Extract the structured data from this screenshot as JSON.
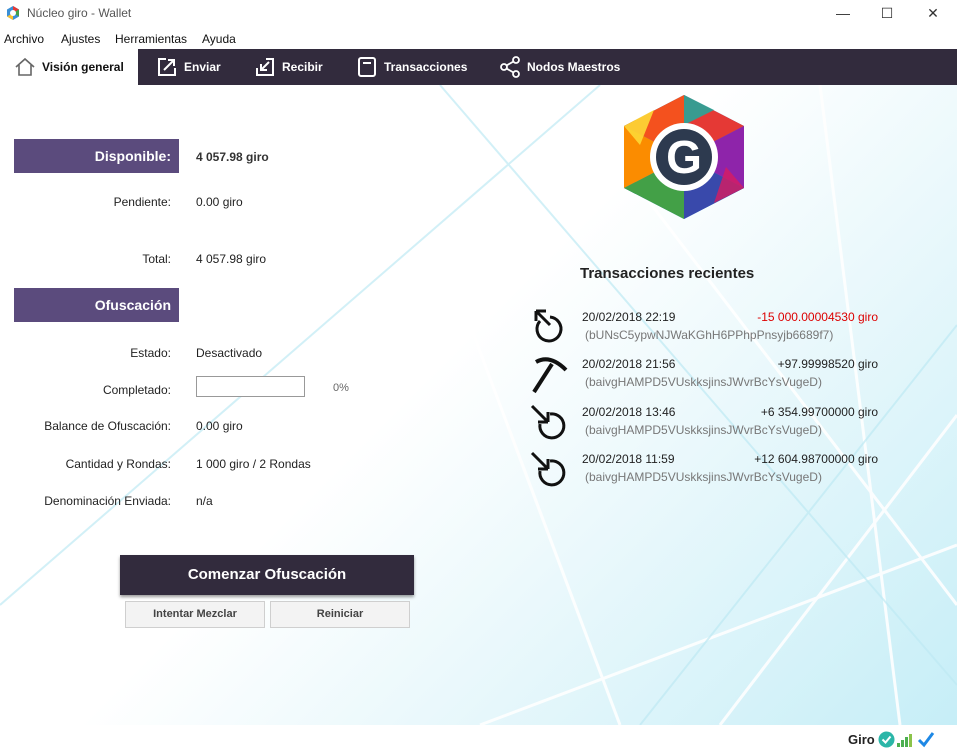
{
  "window": {
    "title": "Núcleo giro - Wallet",
    "minimize": "—",
    "maximize": "☐",
    "close": "✕"
  },
  "menu": [
    "Archivo",
    "Ajustes",
    "Herramientas",
    "Ayuda"
  ],
  "tabs": [
    {
      "label": "Visión general",
      "icon": "home-icon"
    },
    {
      "label": "Enviar",
      "icon": "send-icon"
    },
    {
      "label": "Recibir",
      "icon": "receive-icon"
    },
    {
      "label": "Transacciones",
      "icon": "transactions-icon"
    },
    {
      "label": "Nodos Maestros",
      "icon": "share-icon"
    }
  ],
  "balance": {
    "header": "Disponible:",
    "available": "4 057.98 giro",
    "pending_label": "Pendiente:",
    "pending": "0.00 giro",
    "total_label": "Total:",
    "total": "4 057.98 giro"
  },
  "obfuscation": {
    "header": "Ofuscación",
    "state_label": "Estado:",
    "state": "Desactivado",
    "completed_label": "Completado:",
    "completed_pct": "0%",
    "completed_value": 0,
    "balance_label": "Balance de Ofuscación:",
    "balance": "0.00 giro",
    "amount_label": "Cantidad y Rondas:",
    "amount": "1 000 giro / 2 Rondas",
    "denom_label": "Denominación Enviada:",
    "denom": "n/a",
    "start_button": "Comenzar Ofuscación",
    "try_mix_button": "Intentar Mezclar",
    "reset_button": "Reiniciar"
  },
  "recent": {
    "title": "Transacciones recientes",
    "items": [
      {
        "date": "20/02/2018 22:19",
        "amount": "-15 000.00004530 giro",
        "address": "(bUNsC5ypwNJWaKGhH6PPhpPnsyjb6689f7)",
        "icon": "sent-icon",
        "negative": true
      },
      {
        "date": "20/02/2018 21:56",
        "amount": "+97.99998520 giro",
        "address": "(baivgHAMPD5VUskksjinsJWvrBcYsVugeD)",
        "icon": "mined-icon",
        "negative": false
      },
      {
        "date": "20/02/2018 13:46",
        "amount": "+6 354.99700000 giro",
        "address": "(baivgHAMPD5VUskksjinsJWvrBcYsVugeD)",
        "icon": "received-icon",
        "negative": false
      },
      {
        "date": "20/02/2018 11:59",
        "amount": "+12 604.98700000 giro",
        "address": "(baivgHAMPD5VUskksjinsJWvrBcYsVugeD)",
        "icon": "received-icon",
        "negative": false
      }
    ]
  },
  "status": {
    "label": "Giro"
  },
  "colors": {
    "toolbar": "#322b3d",
    "header": "#5b4b7d",
    "negative": "#dd0000"
  }
}
